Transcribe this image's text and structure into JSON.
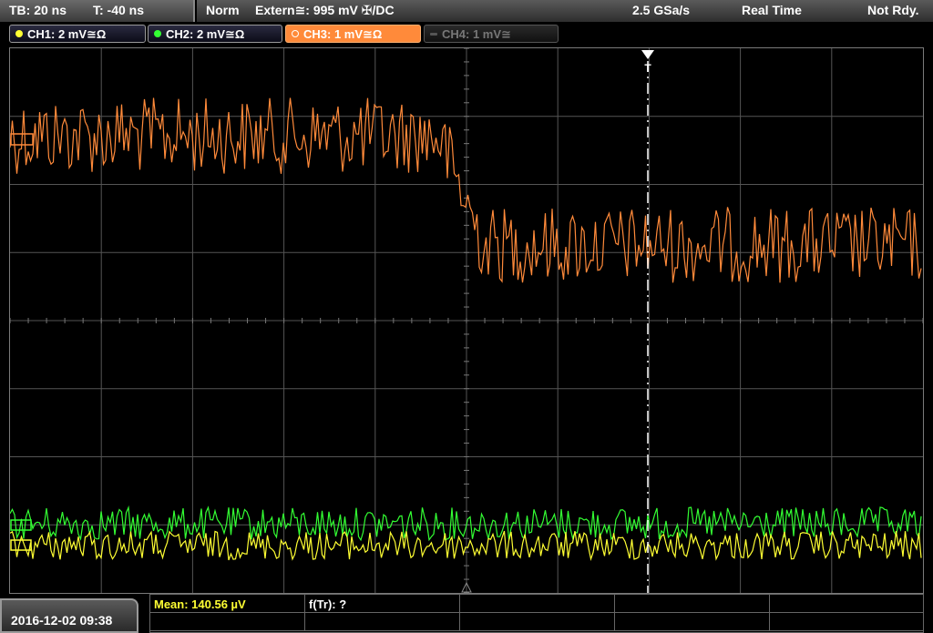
{
  "timebase": {
    "tb": "TB: 20 ns",
    "t": "T: -40 ns"
  },
  "status": {
    "mode": "Norm",
    "trigger": "Extern≅: 995 mV ✠/DC",
    "sample_rate": "2.5 GSa/s",
    "acq": "Real Time",
    "ready": "Not Rdy."
  },
  "channels": [
    {
      "label": "CH1: 2 mV≅Ω",
      "color": "#ffff33",
      "state": "on"
    },
    {
      "label": "CH2: 2 mV≅Ω",
      "color": "#33ff33",
      "state": "on"
    },
    {
      "label": "CH3: 1 mV≅Ω",
      "color": "#ff8a3a",
      "state": "active"
    },
    {
      "label": "CH4: 1 mV≅",
      "color": "#666666",
      "state": "off"
    }
  ],
  "trigger_marker": {
    "label": "T"
  },
  "bottom": {
    "date": "2016-12-02 09:38",
    "meas1": "Mean: 140.56 µV",
    "meas2": "f(Tr): ?"
  },
  "colors": {
    "ch1": "#ffff33",
    "ch2": "#33ff33",
    "ch3": "#ff8a3a",
    "grid": "#555555"
  }
}
